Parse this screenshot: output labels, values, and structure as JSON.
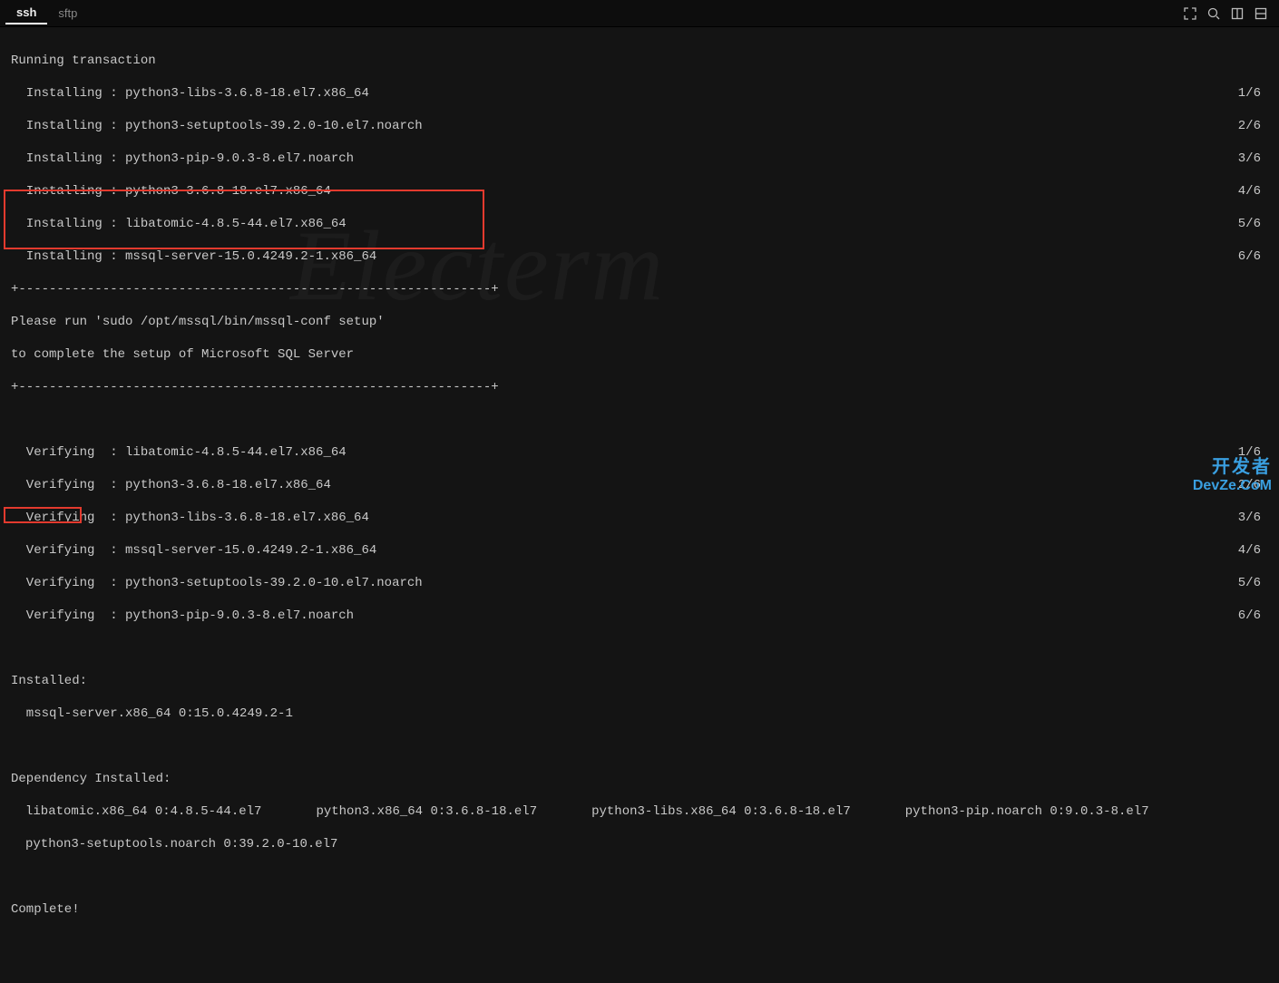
{
  "tabs": {
    "ssh": "ssh",
    "sftp": "sftp"
  },
  "watermark_text": "Electerm",
  "corner_logo": {
    "line1": "开发者",
    "line2": "DevZe.CoM"
  },
  "header_running": "Running transaction",
  "installing": [
    {
      "label": "  Installing : python3-libs-3.6.8-18.el7.x86_64",
      "count": "1/6"
    },
    {
      "label": "  Installing : python3-setuptools-39.2.0-10.el7.noarch",
      "count": "2/6"
    },
    {
      "label": "  Installing : python3-pip-9.0.3-8.el7.noarch",
      "count": "3/6"
    },
    {
      "label": "  Installing : python3-3.6.8-18.el7.x86_64",
      "count": "4/6"
    },
    {
      "label": "  Installing : libatomic-4.8.5-44.el7.x86_64",
      "count": "5/6"
    },
    {
      "label": "  Installing : mssql-server-15.0.4249.2-1.x86_64",
      "count": "6/6"
    }
  ],
  "box_border": "+--------------------------------------------------------------+",
  "box_line1": "Please run 'sudo /opt/mssql/bin/mssql-conf setup'",
  "box_line2": "to complete the setup of Microsoft SQL Server",
  "verifying": [
    {
      "label": "  Verifying  : libatomic-4.8.5-44.el7.x86_64",
      "count": "1/6"
    },
    {
      "label": "  Verifying  : python3-3.6.8-18.el7.x86_64",
      "count": "2/6"
    },
    {
      "label": "  Verifying  : python3-libs-3.6.8-18.el7.x86_64",
      "count": "3/6"
    },
    {
      "label": "  Verifying  : mssql-server-15.0.4249.2-1.x86_64",
      "count": "4/6"
    },
    {
      "label": "  Verifying  : python3-setuptools-39.2.0-10.el7.noarch",
      "count": "5/6"
    },
    {
      "label": "  Verifying  : python3-pip-9.0.3-8.el7.noarch",
      "count": "6/6"
    }
  ],
  "installed_header": "Installed:",
  "installed_pkg": "  mssql-server.x86_64 0:15.0.4249.2-1",
  "dep_header": "Dependency Installed:",
  "deps_row1": {
    "a": "libatomic.x86_64 0:4.8.5-44.el7",
    "b": "python3.x86_64 0:3.6.8-18.el7",
    "c": "python3-libs.x86_64 0:3.6.8-18.el7",
    "d": "python3-pip.noarch 0:9.0.3-8.el7"
  },
  "deps_row2": {
    "a": "python3-setuptools.noarch 0:39.2.0-10.el7"
  },
  "complete": "Complete!"
}
